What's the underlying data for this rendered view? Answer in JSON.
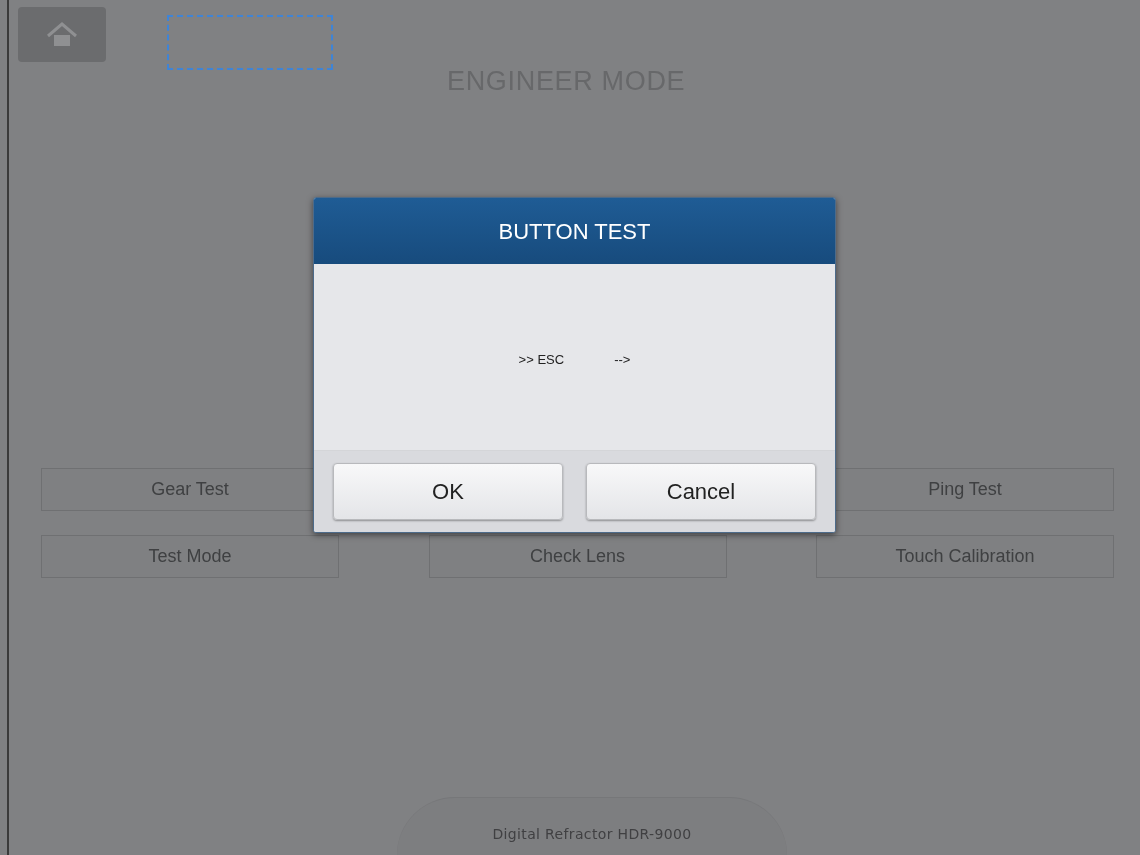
{
  "header": {
    "title": "ENGINEER MODE"
  },
  "menu_rows": [
    {
      "buttons": [
        {
          "label": "Gear Test"
        },
        {
          "label": "Ping Test"
        }
      ]
    },
    {
      "buttons": [
        {
          "label": "Test Mode"
        },
        {
          "label": "Check Lens"
        },
        {
          "label": "Touch Calibration"
        }
      ]
    }
  ],
  "footer": {
    "model": "Digital Refractor HDR-9000"
  },
  "dialog": {
    "title": "BUTTON TEST",
    "message": [
      ">> ESC",
      "-->"
    ],
    "buttons": [
      "OK",
      "Cancel"
    ]
  }
}
